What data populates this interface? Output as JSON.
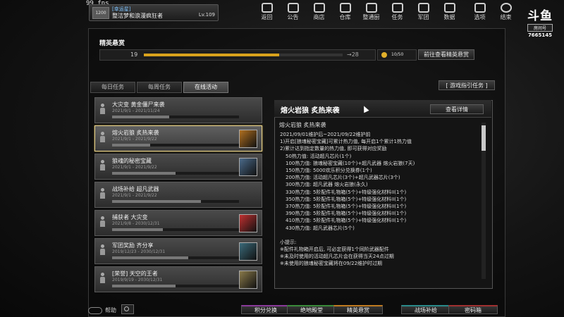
{
  "hud": {
    "fps": "99 fps",
    "profile": {
      "tag": "[幸运星]",
      "name": "整洁梦和浪漫疯狂者",
      "level": "Lv.109",
      "rank": "1200"
    }
  },
  "topnav": [
    {
      "label": "返回",
      "icon": "home-icon"
    },
    {
      "label": "公告",
      "icon": "megaphone-icon"
    },
    {
      "label": "商店",
      "icon": "shop-icon"
    },
    {
      "label": "仓库",
      "icon": "warehouse-icon"
    },
    {
      "label": "整通厨",
      "icon": "lab-icon"
    },
    {
      "label": "任务",
      "icon": "mission-icon"
    },
    {
      "label": "军团",
      "icon": "shield-icon"
    },
    {
      "label": "数据",
      "icon": "chart-icon"
    },
    {
      "label": "选项",
      "icon": "gear-icon"
    },
    {
      "label": "结束",
      "icon": "power-icon"
    }
  ],
  "logo": {
    "mark": "斗鱼",
    "sub": "房间号",
    "room": "7665145"
  },
  "panel": {
    "title": "精英悬赏",
    "progress": {
      "current": "19",
      "max": "28",
      "fraction": 0.68
    },
    "coins": "10/50",
    "goto_button": "前往查看精英悬赏"
  },
  "tabs": [
    {
      "label": "每日任务",
      "active": false
    },
    {
      "label": "每周任务",
      "active": false
    },
    {
      "label": "在线活动",
      "active": true
    }
  ],
  "guide_button": "[ 游戏指引任务 ]",
  "events": [
    {
      "title": "大灾变 黄金僵尸来袭",
      "date": "2021/9/1 - 2021/11/24",
      "progress": 0.45,
      "thumb": ""
    },
    {
      "title": "熔火岩狼 炙热来袭",
      "date": "2021/9/1 - 2021/9/22",
      "progress": 0.3,
      "thumb": "#b07020",
      "selected": true
    },
    {
      "title": "狼魂的秘密宝藏",
      "date": "2021/9/1 - 2021/9/22",
      "progress": 0.5,
      "thumb": "#4a6a8a"
    },
    {
      "title": "战场补给 超凡武器",
      "date": "2021/9/1 - 2021/9/22",
      "progress": 0.7,
      "thumb": ""
    },
    {
      "title": "捕获者 大灾变",
      "date": "2021/9/8 - 2030/12/31",
      "progress": 0.4,
      "thumb": "#c03030"
    },
    {
      "title": "军团奖励 齐分享",
      "date": "2019/12/23 - 2030/12/31",
      "progress": 0.6,
      "thumb": "#3a6a7a"
    },
    {
      "title": "[荣誉] 天空的王者",
      "date": "2019/9/19 - 2030/12/31",
      "progress": 0.5,
      "thumb": "#8a7a4a"
    }
  ],
  "detail": {
    "title": "熔火岩狼 炙热来袭",
    "view_button": "查看详情",
    "subtitle": "熔火岩狼 炙热来袭",
    "lines": [
      {
        "text": "2021/09/01维护后~2021/09/22维护前",
        "indent": false
      },
      {
        "text": "1)开启[狼魂秘密宝藏]可累计热力值, 每开启1个累计1热力值",
        "indent": false
      },
      {
        "text": "2)累计达到指定数量的热力值, 即可获得对应奖励",
        "indent": false
      },
      {
        "text": "50热力值: 活动超凡芯片(1个)",
        "indent": true
      },
      {
        "text": "100热力值: 狼魂秘密宝藏(10个)+超凡武器 熔火岩狼(7天)",
        "indent": true
      },
      {
        "text": "150热力值: 5000欢乐积分兑换券(1个)",
        "indent": true
      },
      {
        "text": "200热力值: 活动超凡芯片(3个)+超凡武器芯片(3个)",
        "indent": true
      },
      {
        "text": "300热力值: 超凡武器 熔火岩狼(永久)",
        "indent": true
      },
      {
        "text": "330热力值: 5阶配件礼物箱(5个)+特级强化材料II(1个)",
        "indent": true
      },
      {
        "text": "350热力值: 5阶配件礼物箱(5个)+特级强化材料II(1个)",
        "indent": true
      },
      {
        "text": "370热力值: 5阶配件礼物箱(5个)+特级强化材料II(1个)",
        "indent": true
      },
      {
        "text": "390热力值: 5阶配件礼物箱(5个)+特级强化材料II(1个)",
        "indent": true
      },
      {
        "text": "410热力值: 5阶配件礼物箱(5个)+特级强化材料II(1个)",
        "indent": true
      },
      {
        "text": "430热力值: 超凡武器芯片(5个)",
        "indent": true
      },
      {
        "text": "",
        "indent": false
      },
      {
        "text": "小提示:",
        "indent": false
      },
      {
        "text": "※配件礼物箱开启后, 可必定获得1个同阶武器配件",
        "indent": false
      },
      {
        "text": "※未及时使用的活动超凡芯片会在获得当天24点过期",
        "indent": false
      },
      {
        "text": "※未使用的狼魂秘密宝藏将在09/22维护时过期",
        "indent": false
      }
    ]
  },
  "bottom": {
    "help": "帮助",
    "buttons": [
      {
        "label": "积分兑换",
        "color": "#8a3a9a"
      },
      {
        "label": "绝地殿堂",
        "color": "#3a8a3a"
      },
      {
        "label": "精英悬赏",
        "color": "#c07a20"
      },
      {
        "label": "战场补给",
        "color": "#2a8a8a"
      },
      {
        "label": "密码箱",
        "color": "#a03030"
      }
    ]
  }
}
